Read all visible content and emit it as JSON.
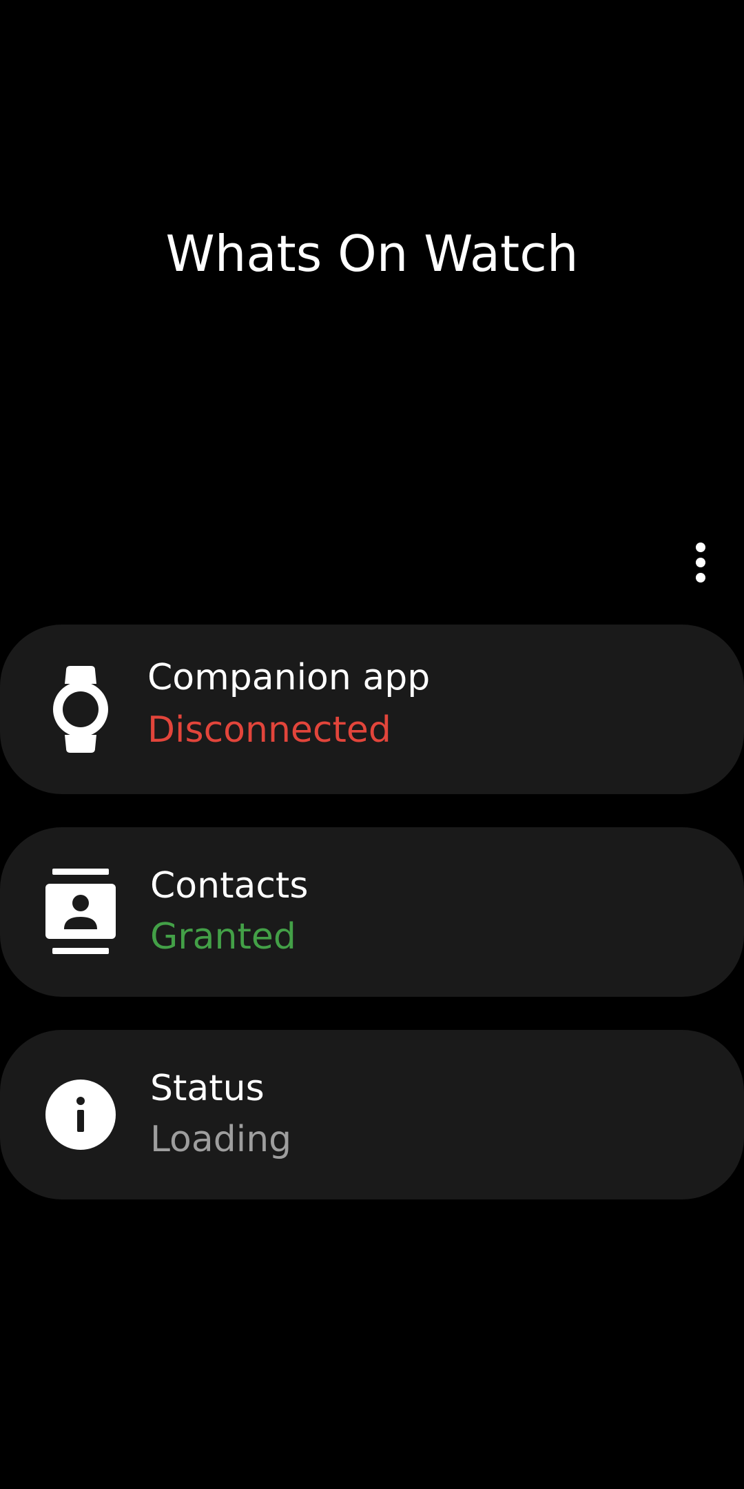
{
  "app": {
    "title": "Whats On Watch"
  },
  "menu": {
    "icon": "more-vert-icon"
  },
  "cards": [
    {
      "title": "Companion app",
      "status": "Disconnected",
      "icon": "watch-icon",
      "status_color": "#e2453b"
    },
    {
      "title": "Contacts",
      "status": "Granted",
      "icon": "contacts-icon",
      "status_color": "#43a047"
    },
    {
      "title": "Status",
      "status": "Loading",
      "icon": "info-icon",
      "status_color": "#9e9e9e"
    }
  ],
  "colors": {
    "background": "#000000",
    "card_background": "#1a1a1a",
    "text_primary": "#ffffff"
  }
}
